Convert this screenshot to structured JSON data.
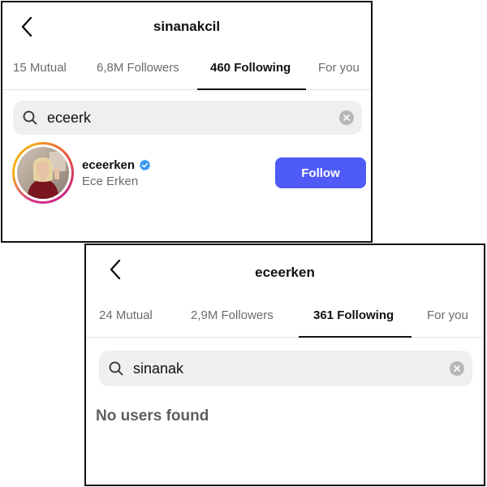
{
  "screen_a": {
    "title": "sinanakcil",
    "tabs": [
      {
        "label": "15 Mutual"
      },
      {
        "label": "6,8M Followers"
      },
      {
        "label": "460 Following"
      },
      {
        "label": "For you"
      }
    ],
    "active_tab": "460 Following",
    "search": {
      "value": "eceerk"
    },
    "result": {
      "username": "eceerken",
      "full_name": "Ece Erken",
      "verified": true,
      "follow_label": "Follow"
    }
  },
  "screen_b": {
    "title": "eceerken",
    "tabs": [
      {
        "label": "24 Mutual"
      },
      {
        "label": "2,9M Followers"
      },
      {
        "label": "361 Following"
      },
      {
        "label": "For you"
      }
    ],
    "active_tab": "361 Following",
    "search": {
      "value": "sinanak"
    },
    "empty_message": "No users found"
  },
  "colors": {
    "follow_button": "#4f5bf7",
    "verified_badge": "#3897f0",
    "search_bg": "#efeff0"
  },
  "icons": [
    "back-chevron-icon",
    "search-icon",
    "clear-icon",
    "verified-badge-icon"
  ]
}
